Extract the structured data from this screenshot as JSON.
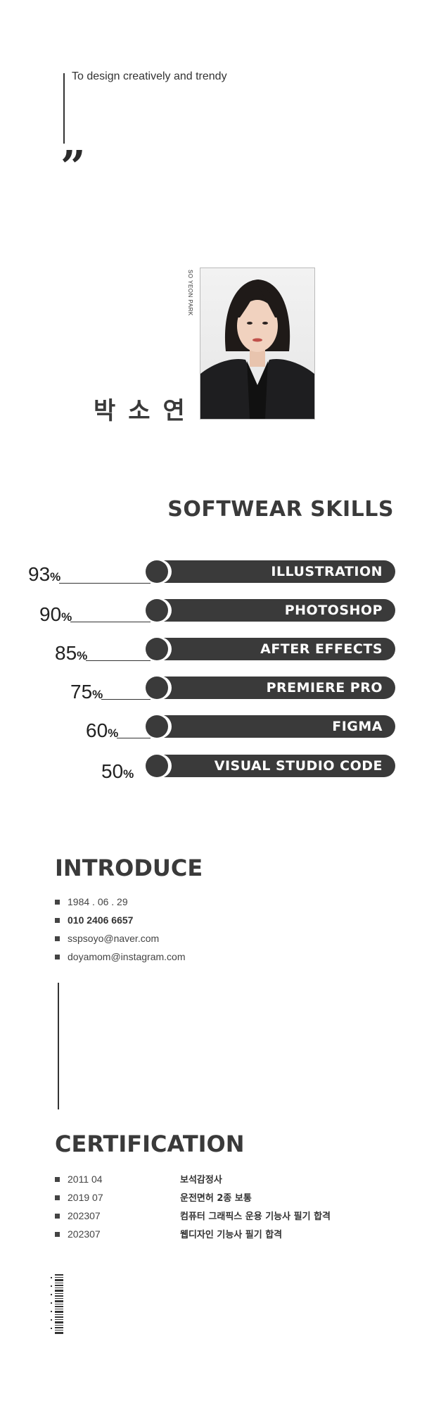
{
  "tagline": "To design creatively and trendy",
  "quote_mark": "”",
  "profile": {
    "english_name": "SO YEON PARK",
    "korean_name": "박소연"
  },
  "skills": {
    "title": "SOFTWEAR SKILLS",
    "items": [
      {
        "label": "ILLUSTRATION",
        "percent": "93",
        "unit": "%"
      },
      {
        "label": "PHOTOSHOP",
        "percent": "90",
        "unit": "%"
      },
      {
        "label": "AFTER EFFECTS",
        "percent": "85",
        "unit": "%"
      },
      {
        "label": "PREMIERE PRO",
        "percent": "75",
        "unit": "%"
      },
      {
        "label": "FIGMA",
        "percent": "60",
        "unit": "%"
      },
      {
        "label": "VISUAL STUDIO CODE",
        "percent": "50",
        "unit": "%"
      }
    ]
  },
  "introduce": {
    "title": "INTRODUCE",
    "items": [
      {
        "text": "1984 . 06 . 29"
      },
      {
        "text": "010 2406 6657"
      },
      {
        "text": "sspsoyo@naver.com"
      },
      {
        "text": "doyamom@instagram.com"
      }
    ]
  },
  "certification": {
    "title": "CERTIFICATION",
    "items": [
      {
        "date": "2011  04",
        "name": "보석감정사"
      },
      {
        "date": "2019 07",
        "name": "운전면허 2종 보통"
      },
      {
        "date": "202307",
        "name": "컴퓨터 그래픽스 운용 기능사 필기 합격"
      },
      {
        "date": "202307",
        "name": "웹디자인 기능사 필기 합격"
      }
    ]
  },
  "colors": {
    "primary": "#3a3a3a",
    "background": "#ffffff"
  }
}
